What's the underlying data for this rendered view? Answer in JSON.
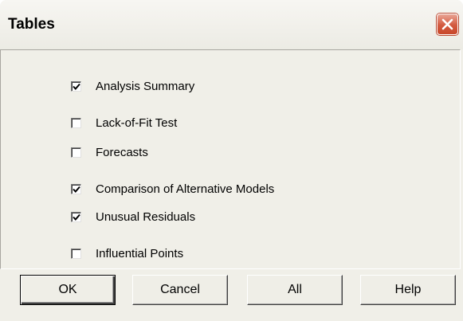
{
  "window": {
    "title": "Tables"
  },
  "options": [
    {
      "label": "Analysis Summary",
      "checked": true
    },
    {
      "label": "Lack-of-Fit Test",
      "checked": false
    },
    {
      "label": "Forecasts",
      "checked": false
    },
    {
      "label": "Comparison of Alternative Models",
      "checked": true
    },
    {
      "label": "Unusual Residuals",
      "checked": true
    },
    {
      "label": "Influential Points",
      "checked": false
    }
  ],
  "buttons": {
    "ok_label": "OK",
    "cancel_label": "Cancel",
    "all_label": "All",
    "help_label": "Help"
  },
  "icons": {
    "close": "close-x-icon",
    "check": "checkmark-icon"
  },
  "colors": {
    "dialog_background": "#f0efe8",
    "close_button": "#d35a3f"
  }
}
